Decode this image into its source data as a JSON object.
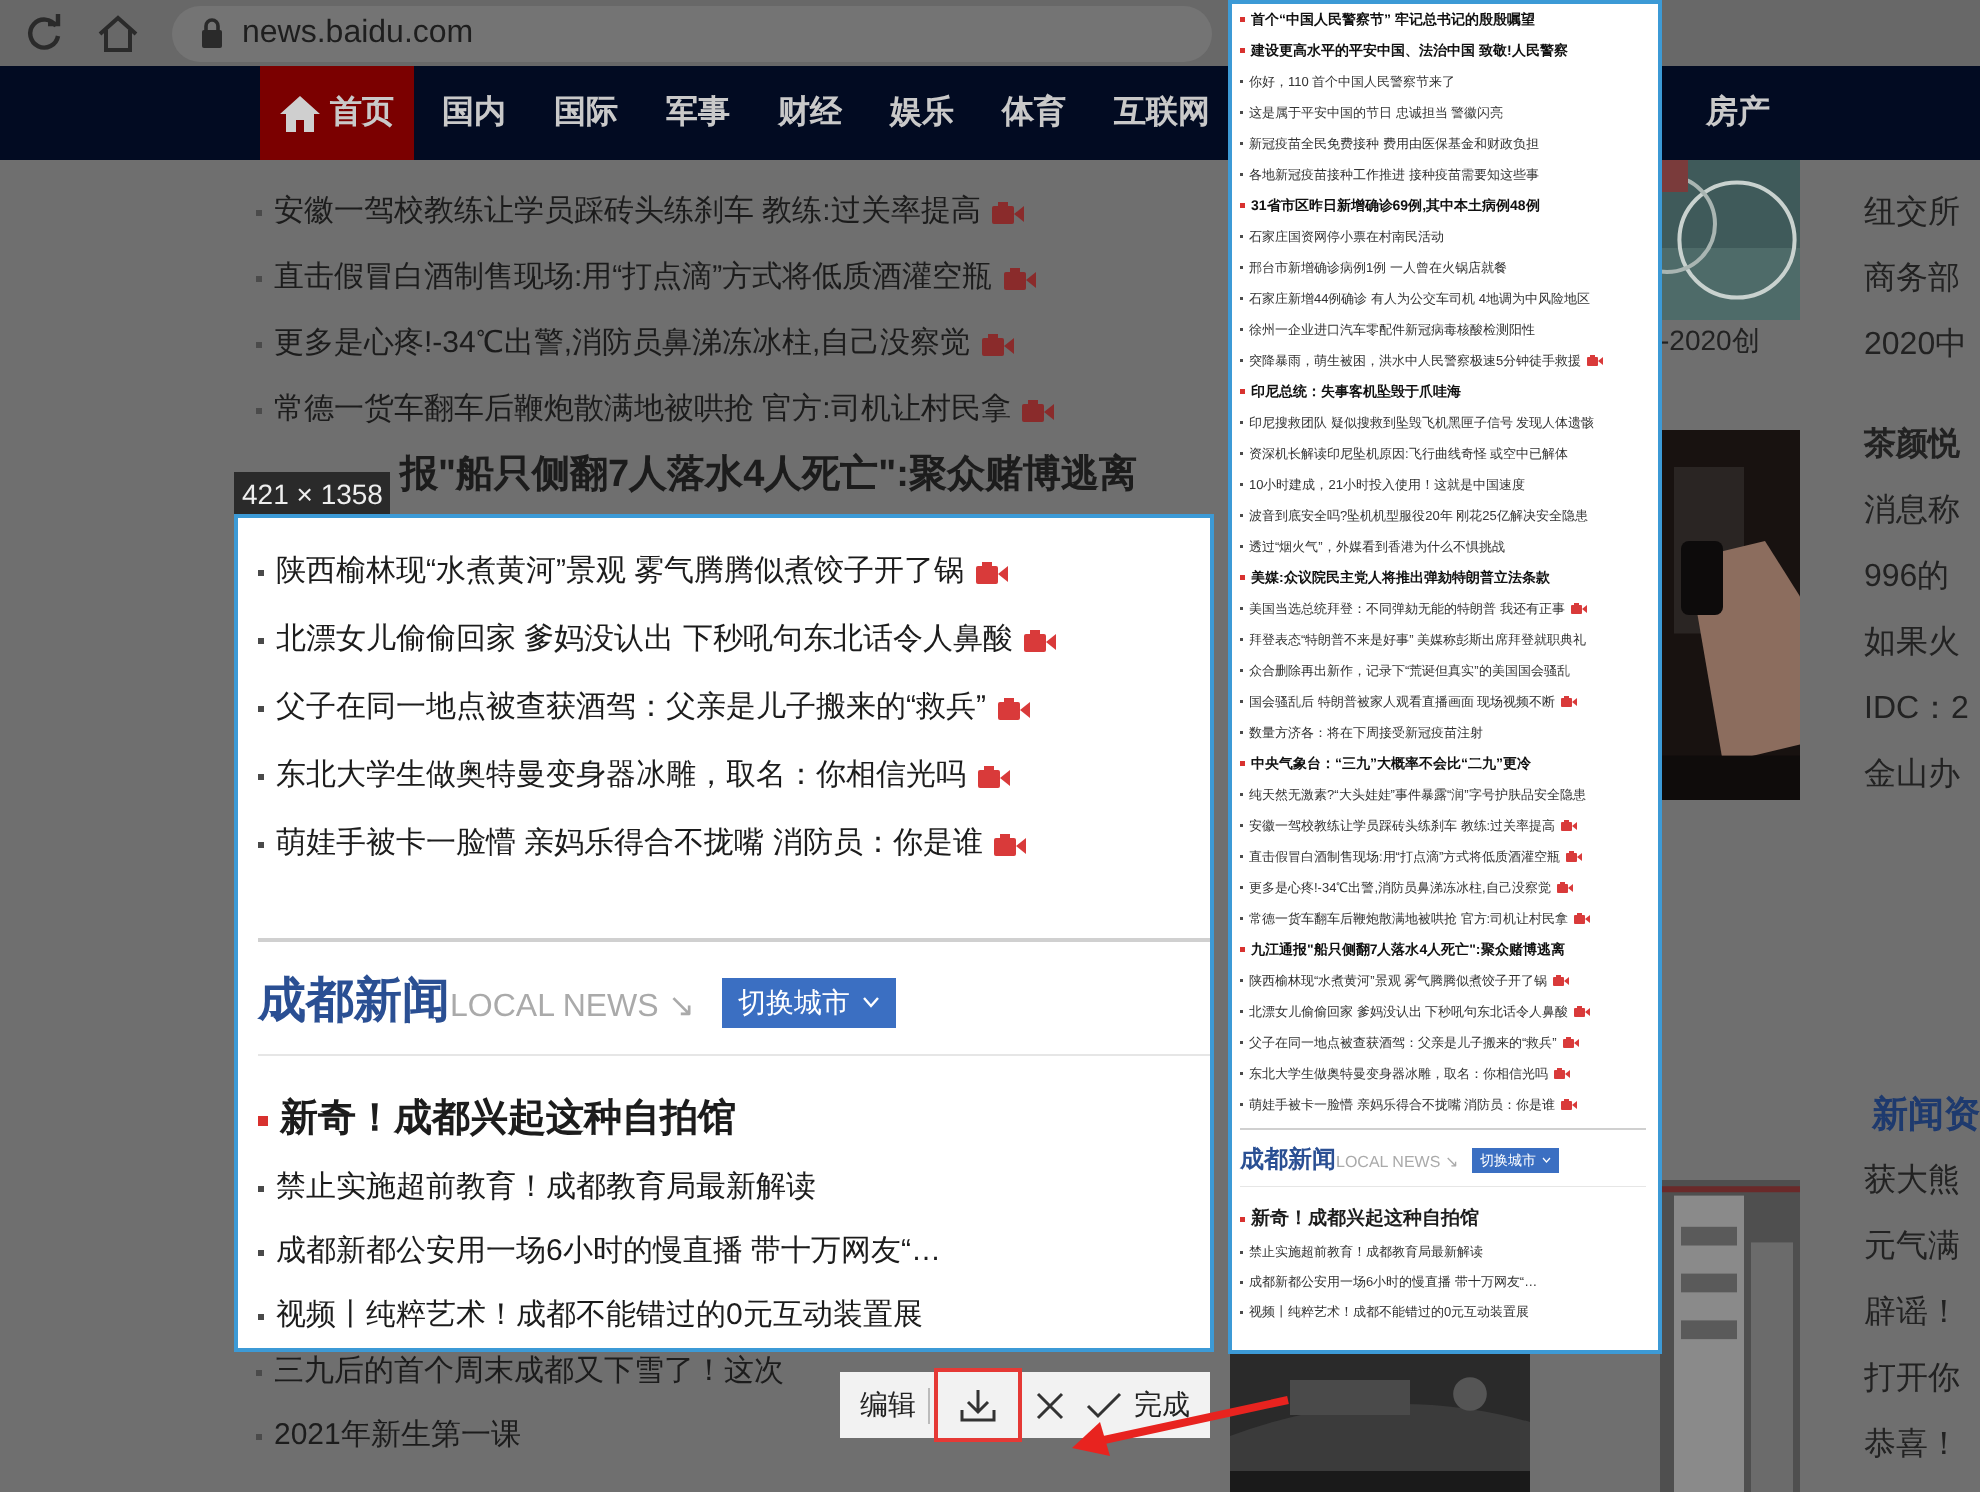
{
  "browser": {
    "url": "news.baidu.com"
  },
  "nav": {
    "left": [
      {
        "label": "首页",
        "kind": "home",
        "selected": true
      },
      {
        "label": "国内",
        "kind": "text",
        "selected": false
      },
      {
        "label": "国际",
        "kind": "text",
        "selected": false
      },
      {
        "label": "军事",
        "kind": "text",
        "selected": false
      },
      {
        "label": "财经",
        "kind": "text",
        "selected": false
      },
      {
        "label": "娱乐",
        "kind": "text",
        "selected": false
      },
      {
        "label": "体育",
        "kind": "text",
        "selected": false
      },
      {
        "label": "互联网",
        "kind": "text",
        "selected": false
      }
    ],
    "right": [
      {
        "label": "房产",
        "kind": "text",
        "selected": false
      }
    ]
  },
  "page": {
    "items": [
      {
        "text": "安徽一驾校教练让学员踩砖头练刹车 教练:过关率提高",
        "video": true
      },
      {
        "text": "直击假冒白酒制售现场:用“打点滴”方式将低质酒灌空瓶",
        "video": true
      },
      {
        "text": "更多是心疼!-34℃出警,消防员鼻涕冻冰柱,自己没察觉",
        "video": true
      },
      {
        "text": "常德一货车翻车后鞭炮散满地被哄抢 官方:司机让村民拿",
        "video": true
      }
    ],
    "headline": "报\"船只侧翻7人落水4人死亡\":聚众赌博逃离",
    "bottom_items": [
      {
        "text": "三九后的首个周末成都又下雪了！这次",
        "video": false
      },
      {
        "text": "2021年新生第一课",
        "video": false
      }
    ],
    "photo_caption": "-2020创",
    "side_texts": [
      {
        "kind": "text",
        "text": "纽交所"
      },
      {
        "kind": "text",
        "text": "商务部"
      },
      {
        "kind": "text",
        "text": "2020中"
      },
      {
        "kind": "bold",
        "text": "茶颜悦"
      },
      {
        "kind": "text",
        "text": "消息称"
      },
      {
        "kind": "text",
        "text": "996的"
      },
      {
        "kind": "text",
        "text": "如果火"
      },
      {
        "kind": "text",
        "text": "IDC：2"
      },
      {
        "kind": "text",
        "text": "金山办"
      },
      {
        "kind": "section",
        "text": "新闻资"
      },
      {
        "kind": "text",
        "text": "获大熊"
      },
      {
        "kind": "text",
        "text": "元气满"
      },
      {
        "kind": "text",
        "text": "辟谣！"
      },
      {
        "kind": "text",
        "text": "打开你"
      },
      {
        "kind": "text",
        "text": "恭喜！"
      }
    ]
  },
  "capture": {
    "size_label": "421 × 1358",
    "selection": {
      "items": [
        {
          "text": "陕西榆林现“水煮黄河”景观 雾气腾腾似煮饺子开了锅",
          "video": true
        },
        {
          "text": "北漂女儿偷偷回家 爹妈没认出 下秒吼句东北话令人鼻酸",
          "video": true
        },
        {
          "text": "父子在同一地点被查获酒驾：父亲是儿子搬来的“救兵”",
          "video": true
        },
        {
          "text": "东北大学生做奥特曼变身器冰雕，取名：你相信光吗",
          "video": true
        },
        {
          "text": "萌娃手被卡一脸懵 亲妈乐得合不拢嘴 消防员：你是谁",
          "video": true
        }
      ],
      "local": {
        "title": "成都新闻",
        "subtitle": "LOCAL NEWS ↘",
        "button": "切换城市",
        "headline": "新奇！成都兴起这种自拍馆",
        "items": [
          {
            "text": "禁止实施超前教育！成都教育局最新解读",
            "video": false
          },
          {
            "text": "成都新都公安用一场6小时的慢直播 带十万网友“…",
            "video": false
          },
          {
            "text": "视频丨纯粹艺术！成都不能错过的0元互动装置展",
            "video": false
          }
        ]
      }
    },
    "preview": {
      "items": [
        {
          "kind": "headline",
          "text": "首个“中国人民警察节” 牢记总书记的殷殷嘱望",
          "video": false
        },
        {
          "kind": "headline",
          "text": "建设更高水平的平安中国、法治中国 致敬!人民警察",
          "video": false
        },
        {
          "kind": "item",
          "text": "你好，110 首个中国人民警察节来了",
          "video": false
        },
        {
          "kind": "item",
          "text": "这是属于平安中国的节日 忠诚担当 警徽闪亮",
          "video": false
        },
        {
          "kind": "item",
          "text": "新冠疫苗全民免费接种 费用由医保基金和财政负担",
          "video": false
        },
        {
          "kind": "item",
          "text": "各地新冠疫苗接种工作推进 接种疫苗需要知这些事",
          "video": false
        },
        {
          "kind": "headline",
          "text": "31省市区昨日新增确诊69例,其中本土病例48例",
          "video": false
        },
        {
          "kind": "item",
          "text": "石家庄国资网停小票在村南民活动",
          "video": false
        },
        {
          "kind": "item",
          "text": "邢台市新增确诊病例1例 一人曾在火锅店就餐",
          "video": false
        },
        {
          "kind": "item",
          "text": "石家庄新增44例确诊 有人为公交车司机 4地调为中风险地区",
          "video": false
        },
        {
          "kind": "item",
          "text": "徐州一企业进口汽车零配件新冠病毒核酸检测阳性",
          "video": false
        },
        {
          "kind": "item",
          "text": "突降暴雨，萌生被困，洪水中人民警察极速5分钟徒手救援",
          "video": true
        },
        {
          "kind": "headline",
          "text": "印尼总统：失事客机坠毁于爪哇海",
          "video": false
        },
        {
          "kind": "item",
          "text": "印尼搜救团队 疑似搜救到坠毁飞机黑匣子信号 发现人体遗骸",
          "video": false
        },
        {
          "kind": "item",
          "text": "资深机长解读印尼坠机原因:飞行曲线奇怪 或空中已解体",
          "video": false
        },
        {
          "kind": "item",
          "text": "10小时建成，21小时投入使用！这就是中国速度",
          "video": false
        },
        {
          "kind": "item",
          "text": "波音到底安全吗?坠机机型服役20年 刚花25亿解决安全隐患",
          "video": false
        },
        {
          "kind": "item",
          "text": "透过“烟火气”，外媒看到香港为什么不惧挑战",
          "video": false
        },
        {
          "kind": "headline",
          "text": "美媒:众议院民主党人将推出弹劾特朗普立法条款",
          "video": false
        },
        {
          "kind": "item",
          "text": "美国当选总统拜登：不同弹劾无能的特朗普 我还有正事",
          "video": true
        },
        {
          "kind": "item",
          "text": "拜登表态“特朗普不来是好事” 美媒称彭斯出席拜登就职典礼",
          "video": false
        },
        {
          "kind": "item",
          "text": "众合删除再出新作，记录下“荒诞但真实”的美国国会骚乱",
          "video": false
        },
        {
          "kind": "item",
          "text": "国会骚乱后 特朗普被家人观看直播画面 现场视频不断",
          "video": true
        },
        {
          "kind": "item",
          "text": "数量方济各：将在下周接受新冠疫苗注射",
          "video": false
        },
        {
          "kind": "headline",
          "text": "中央气象台：“三九”大概率不会比“二九”更冷",
          "video": false
        },
        {
          "kind": "item",
          "text": "纯天然无激素?“大头娃娃”事件暴露“润”字号护肤品安全隐患",
          "video": false
        },
        {
          "kind": "item",
          "text": "安徽一驾校教练让学员踩砖头练刹车 教练:过关率提高",
          "video": true
        },
        {
          "kind": "item",
          "text": "直击假冒白酒制售现场:用“打点滴”方式将低质酒灌空瓶",
          "video": true
        },
        {
          "kind": "item",
          "text": "更多是心疼!-34℃出警,消防员鼻涕冻冰柱,自己没察觉",
          "video": true
        },
        {
          "kind": "item",
          "text": "常德一货车翻车后鞭炮散满地被哄抢 官方:司机让村民拿",
          "video": true
        },
        {
          "kind": "headline",
          "text": "九江通报\"船只侧翻7人落水4人死亡\":聚众赌博逃离",
          "video": false
        },
        {
          "kind": "item",
          "text": "陕西榆林现“水煮黄河”景观 雾气腾腾似煮饺子开了锅",
          "video": true
        },
        {
          "kind": "item",
          "text": "北漂女儿偷偷回家 爹妈没认出 下秒吼句东北话令人鼻酸",
          "video": true
        },
        {
          "kind": "item",
          "text": "父子在同一地点被查获酒驾：父亲是儿子搬来的“救兵”",
          "video": true
        },
        {
          "kind": "item",
          "text": "东北大学生做奥特曼变身器冰雕，取名：你相信光吗",
          "video": true
        },
        {
          "kind": "item",
          "text": "萌娃手被卡一脸懵 亲妈乐得合不拢嘴 消防员：你是谁",
          "video": true
        }
      ],
      "local": {
        "title": "成都新闻",
        "subtitle": "LOCAL NEWS ↘",
        "button": "切换城市",
        "headline": "新奇！成都兴起这种自拍馆",
        "items": [
          {
            "text": "禁止实施超前教育！成都教育局最新解读",
            "video": false
          },
          {
            "text": "成都新都公安用一场6小时的慢直播 带十万网友“…",
            "video": false
          },
          {
            "text": "视频丨纯粹艺术！成都不能错过的0元互动装置展",
            "video": false
          }
        ]
      }
    },
    "toolbar": {
      "edit": "编辑",
      "done": "完成",
      "download_highlighted": true
    }
  }
}
